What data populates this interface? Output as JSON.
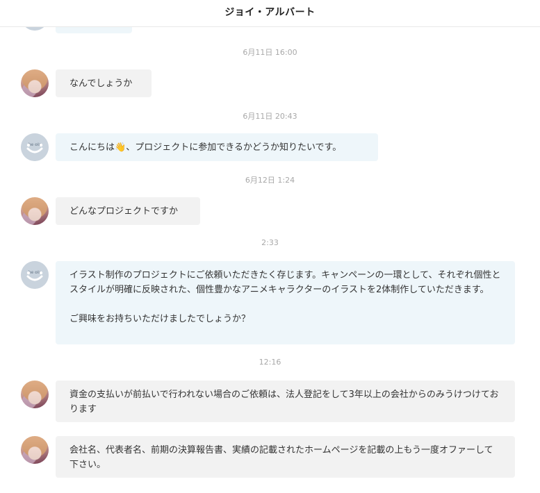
{
  "header": {
    "title": "ジョイ・アルバート"
  },
  "messages": [
    {
      "timestamp": "6月11日 16:00",
      "sender": "anime",
      "text": "なんでしょうか"
    },
    {
      "timestamp": "6月11日 20:43",
      "sender": "logo",
      "text_before_emoji": "こんにちは",
      "emoji": "👋",
      "text_after_emoji": "、プロジェクトに参加できるかどうか知りたいです。"
    },
    {
      "timestamp": "6月12日 1:24",
      "sender": "anime",
      "text": "どんなプロジェクトですか"
    },
    {
      "timestamp": "2:33",
      "sender": "logo",
      "text": "イラスト制作のプロジェクトにご依頼いただきたく存じます。キャンペーンの一環として、それぞれ個性とスタイルが明確に反映された、個性豊かなアニメキャラクターのイラストを2体制作していただきます。\n\nご興味をお持ちいただけましたでしょうか？"
    },
    {
      "timestamp": "12:16",
      "sender": "anime",
      "text": "資金の支払いが前払いで行われない場合のご依頼は、法人登記をして3年以上の会社からのみうけつけております"
    },
    {
      "timestamp": "",
      "sender": "anime",
      "text": "会社名、代表者名、前期の決算報告書、実績の記載されたホームページを記載の上もう一度オファーして下さい。"
    }
  ],
  "icons": {
    "emoji_name": "waving-hand-icon",
    "logo_avatar_text": "heOblodge"
  }
}
